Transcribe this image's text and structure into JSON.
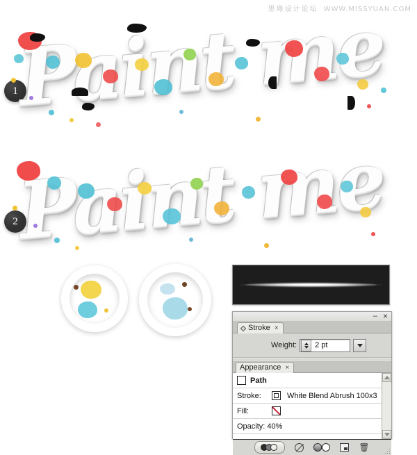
{
  "watermark": {
    "cn": "思缘设计论坛",
    "url": "WWW.MISSYUAN.COM"
  },
  "steps": [
    {
      "number": "1",
      "name": "step-badge-1"
    },
    {
      "number": "2",
      "name": "step-badge-2"
    }
  ],
  "artwork": {
    "word": "Paint me",
    "version_1_caption": "1",
    "version_2_caption": "2"
  },
  "insets": [
    {
      "label": "detail-yellow-splatter"
    },
    {
      "label": "detail-blue-splatter"
    }
  ],
  "brush_preview": {
    "name": "white-blend-abrush-preview",
    "background": "#1d1d1d",
    "stroke_color": "#ffffff"
  },
  "stroke_panel": {
    "tab_label": "Stroke",
    "tab_close": "×",
    "minimize": "–",
    "close": "×",
    "weight_label": "Weight:",
    "weight_value": "2 pt"
  },
  "appearance_panel": {
    "tab_label": "Appearance",
    "tab_close": "×",
    "rows": [
      {
        "type": "head",
        "label": "Path",
        "swatch": "white"
      },
      {
        "type": "attr",
        "label": "Stroke:",
        "value": "White Blend Abrush 100x3",
        "swatch": "inner"
      },
      {
        "type": "attr",
        "label": "Fill:",
        "value": "",
        "swatch": "none"
      },
      {
        "type": "plain",
        "label": "Opacity: 40%",
        "value": ""
      }
    ],
    "footer_buttons": [
      {
        "name": "opacity-button",
        "title": "Opacity"
      },
      {
        "name": "clear-appearance-button",
        "title": "Clear Appearance"
      },
      {
        "name": "reduce-to-basic-appearance-button",
        "title": "Reduce to Basic Appearance"
      },
      {
        "name": "duplicate-item-button",
        "title": "Duplicate Selected Item"
      },
      {
        "name": "delete-item-button",
        "title": "Delete Selected Item"
      }
    ]
  },
  "colors": {
    "panel_bg": "#d6d6d3",
    "panel_border": "#a0a0a0",
    "list_bg": "#ffffff",
    "fill_none": "#c0122a",
    "badge_bg": "#333333"
  }
}
